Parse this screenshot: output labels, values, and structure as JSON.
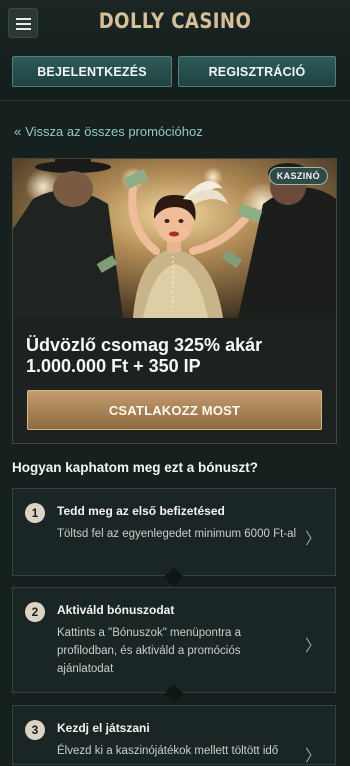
{
  "header": {
    "logo": "DOLLY CASINO",
    "menu_icon": "hamburger-menu-icon",
    "login_label": "BEJELENTKEZÉS",
    "register_label": "REGISZTRÁCIÓ"
  },
  "back_link": {
    "chevron": "«",
    "label": "Vissza az összes promócióhoz"
  },
  "promo": {
    "badge": "KASZINÓ",
    "title": "Üdvözlő csomag 325% akár 1.000.000 Ft + 350 IP",
    "cta_label": "CSATLAKOZZ MOST"
  },
  "how": {
    "title": "Hogyan kaphatom meg ezt a bónuszt?",
    "steps": [
      {
        "num": "1",
        "title": "Tedd meg az első befizetésed",
        "text": "Töltsd fel az egyenlegedet minimum 6000 Ft-al"
      },
      {
        "num": "2",
        "title": "Aktiváld bónuszodat",
        "text": "Kattints a \"Bónuszok\" menüpontra a profilodban, és aktiváld a promóciós ajánlatodat"
      },
      {
        "num": "3",
        "title": "Kezdj el játszani",
        "text": "Élvezd ki a kaszinójátékok mellett töltött idő"
      }
    ],
    "chevron": "〉"
  },
  "colors": {
    "accent_teal": "#2e5a58",
    "accent_gold": "#c39c6c",
    "background": "#16201f"
  }
}
